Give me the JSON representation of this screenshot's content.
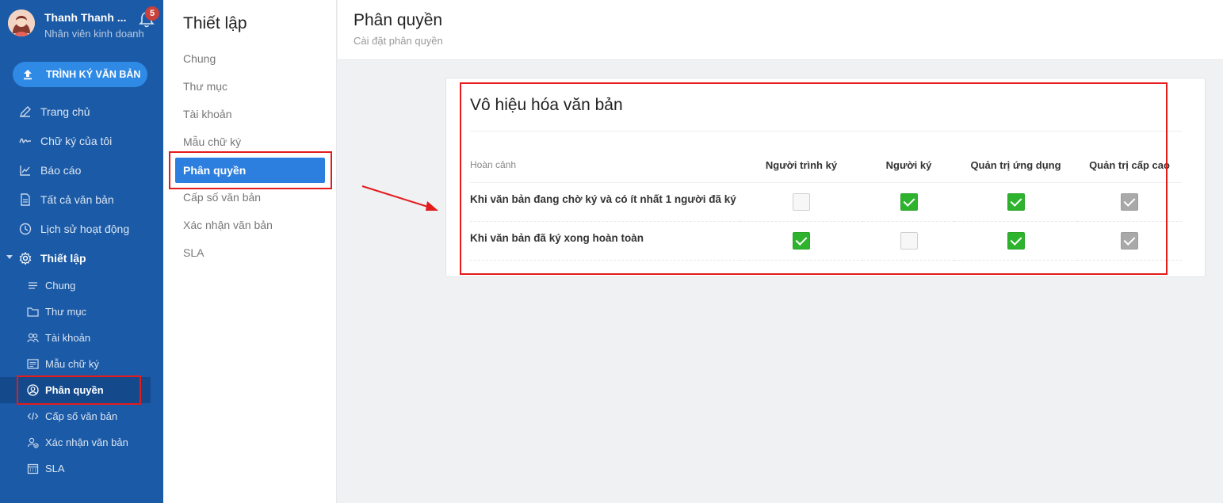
{
  "user": {
    "name": "Thanh Thanh ...",
    "role": "Nhân viên kinh doanh",
    "notifications": "5"
  },
  "upload_button": "TRÌNH KÝ VĂN BẢN",
  "nav": [
    {
      "label": "Trang chủ",
      "icon": "pen-icon"
    },
    {
      "label": "Chữ ký của tôi",
      "icon": "signature-icon"
    },
    {
      "label": "Báo cáo",
      "icon": "chart-line-icon"
    },
    {
      "label": "Tất cả văn bản",
      "icon": "document-icon"
    },
    {
      "label": "Lịch sử hoạt động",
      "icon": "clock-icon"
    },
    {
      "label": "Thiết lập",
      "icon": "gear-icon"
    }
  ],
  "subnav": [
    {
      "label": "Chung",
      "icon": "list-icon"
    },
    {
      "label": "Thư mục",
      "icon": "folder-icon"
    },
    {
      "label": "Tài khoản",
      "icon": "users-icon"
    },
    {
      "label": "Mẫu chữ ký",
      "icon": "template-icon"
    },
    {
      "label": "Phân quyền",
      "icon": "user-circle-icon"
    },
    {
      "label": "Cấp số văn bản",
      "icon": "code-icon"
    },
    {
      "label": "Xác nhận văn bản",
      "icon": "user-check-icon"
    },
    {
      "label": "SLA",
      "icon": "calendar-icon"
    }
  ],
  "settings": {
    "title": "Thiết lập",
    "items": [
      "Chung",
      "Thư mục",
      "Tài khoản",
      "Mẫu chữ ký",
      "Phân quyền",
      "Cấp số văn bản",
      "Xác nhận văn bản",
      "SLA"
    ],
    "active": "Phân quyền"
  },
  "page": {
    "title": "Phân quyền",
    "subtitle": "Cài đặt phân quyền"
  },
  "card": {
    "title": "Vô hiệu hóa văn bản",
    "columns": [
      "Hoàn cảnh",
      "Người trình ký",
      "Người ký",
      "Quản trị ứng dụng",
      "Quản trị cấp cao"
    ],
    "rows": [
      {
        "label": "Khi văn bản đang chờ ký và có ít nhất 1 người đã ký",
        "values": [
          "off",
          "on",
          "on",
          "disabled-on"
        ]
      },
      {
        "label": "Khi văn bản đã ký xong hoàn toàn",
        "values": [
          "on",
          "off",
          "on",
          "disabled-on"
        ]
      }
    ]
  },
  "colors": {
    "sidebar": "#1b5aa6",
    "accent": "#2d7fdf",
    "checked": "#2db32d",
    "highlight": "#e31b1b"
  }
}
